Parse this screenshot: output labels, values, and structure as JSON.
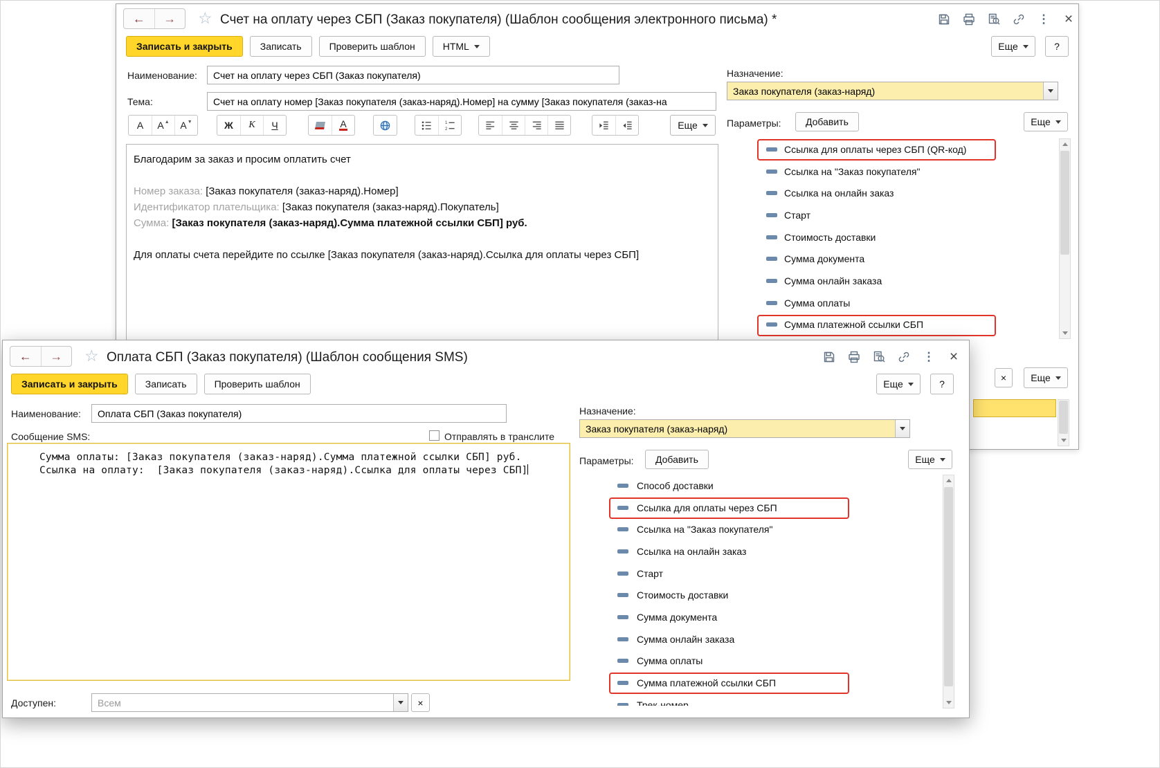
{
  "colors": {
    "accent_yellow": "#ffd629",
    "assignment_field_yellow": "#fcefae",
    "annotation_red": "#e2352a"
  },
  "icons": {
    "back_arrow": "←",
    "forward_arrow": "→",
    "favorite_star": "☆",
    "menu_kebab": "⋮",
    "close": "×"
  },
  "email_window": {
    "title": "Счет на оплату через СБП (Заказ покупателя) (Шаблон сообщения электронного письма) *",
    "toolbar": {
      "save_close": "Записать и закрыть",
      "save": "Записать",
      "check_template": "Проверить шаблон",
      "html": "HTML",
      "more": "Еще",
      "help": "?"
    },
    "name_field": {
      "label": "Наименование:",
      "value": "Счет на оплату через СБП (Заказ покупателя)"
    },
    "subject_field": {
      "label": "Тема:",
      "value": "Счет на оплату номер [Заказ покупателя (заказ-наряд).Номер] на сумму [Заказ покупателя (заказ-на"
    },
    "format_toolbar": {
      "more": "Еще"
    },
    "body": {
      "intro": "Благодарим за заказ и просим оплатить счет",
      "order_label": "Номер заказа: ",
      "order_value": "[Заказ покупателя (заказ-наряд).Номер]",
      "payer_label": "Идентификатор плательщика: ",
      "payer_value": "[Заказ покупателя (заказ-наряд).Покупатель]",
      "amount_label": "Сумма: ",
      "amount_value": "[Заказ покупателя (заказ-наряд).Сумма платежной ссылки СБП] руб.",
      "pay_instruction": "Для оплаты счета перейдите по ссылке [Заказ покупателя (заказ-наряд).Ссылка для оплаты через СБП]"
    },
    "assignment": {
      "label": "Назначение:",
      "value": "Заказ покупателя (заказ-наряд)"
    },
    "parameters": {
      "label": "Параметры:",
      "add": "Добавить",
      "more": "Еще",
      "items": [
        {
          "label": "Ссылка для оплаты через СБП (QR-код)",
          "highlighted": true
        },
        {
          "label": "Ссылка на \"Заказ покупателя\"",
          "highlighted": false
        },
        {
          "label": "Ссылка на онлайн заказ",
          "highlighted": false
        },
        {
          "label": "Старт",
          "highlighted": false
        },
        {
          "label": "Стоимость доставки",
          "highlighted": false
        },
        {
          "label": "Сумма документа",
          "highlighted": false
        },
        {
          "label": "Сумма онлайн заказа",
          "highlighted": false
        },
        {
          "label": "Сумма оплаты",
          "highlighted": false
        },
        {
          "label": "Сумма платежной ссылки СБП",
          "highlighted": true
        }
      ]
    },
    "edge_strip": {
      "more": "Еще"
    }
  },
  "sms_window": {
    "title": "Оплата СБП (Заказ покупателя) (Шаблон сообщения SMS)",
    "toolbar": {
      "save_close": "Записать и закрыть",
      "save": "Записать",
      "check_template": "Проверить шаблон",
      "more": "Еще",
      "help": "?"
    },
    "name_field": {
      "label": "Наименование:",
      "value": "Оплата СБП (Заказ покупателя)"
    },
    "message": {
      "label": "Сообщение SMS:",
      "translit_label": "Отправлять в транслите",
      "line1": "Сумма оплаты: [Заказ покупателя (заказ-наряд).Сумма платежной ссылки СБП] руб.",
      "line2": "Ссылка на оплату:  [Заказ покупателя (заказ-наряд).Ссылка для оплаты через СБП]"
    },
    "available": {
      "label": "Доступен:",
      "placeholder": "Всем"
    },
    "assignment": {
      "label": "Назначение:",
      "value": "Заказ покупателя (заказ-наряд)"
    },
    "parameters": {
      "label": "Параметры:",
      "add": "Добавить",
      "more": "Еще",
      "items": [
        {
          "label": "Способ доставки",
          "highlighted": false
        },
        {
          "label": "Ссылка для оплаты через СБП",
          "highlighted": true
        },
        {
          "label": "Ссылка на \"Заказ покупателя\"",
          "highlighted": false
        },
        {
          "label": "Ссылка на онлайн заказ",
          "highlighted": false
        },
        {
          "label": "Старт",
          "highlighted": false
        },
        {
          "label": "Стоимость доставки",
          "highlighted": false
        },
        {
          "label": "Сумма документа",
          "highlighted": false
        },
        {
          "label": "Сумма онлайн заказа",
          "highlighted": false
        },
        {
          "label": "Сумма оплаты",
          "highlighted": false
        },
        {
          "label": "Сумма платежной ссылки СБП",
          "highlighted": true
        },
        {
          "label": "Трек-номер",
          "highlighted": false
        }
      ]
    }
  }
}
